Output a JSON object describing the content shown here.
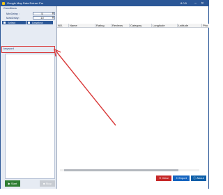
{
  "window": {
    "title": "Google Map Data Extract Pro",
    "version": "8.0.5",
    "min_glyph": "–",
    "close_glyph": "✕"
  },
  "conditions": {
    "group_label": "Conditions",
    "min_delay_label": "MinDelay :",
    "min_delay_value": "5",
    "max_delay_label": "MaxDelay :",
    "max_delay_value": "10",
    "select_label": "Select",
    "deselect_label": "Unselect",
    "keyword_label": "keyword"
  },
  "actions": {
    "start_label": "Start",
    "stop_label": "Stop",
    "clear_label": "Clear",
    "export_label": "Export",
    "about_label": "About"
  },
  "table": {
    "columns": [
      "NO.",
      "Name",
      "Rating",
      "Reviews",
      "Category",
      "Longitude",
      "Latitude",
      "Pho"
    ]
  },
  "icons": {
    "start": "play-icon",
    "stop": "stop-icon",
    "clear": "clear-icon",
    "export": "export-icon",
    "about": "info-icon",
    "app": "app-icon"
  },
  "colors": {
    "chrome_blue": "#2b5797",
    "panel_bg": "#e6ebf3",
    "highlight_red": "#d93a3a",
    "start_green": "#2e7d32",
    "clear_red": "#c62828",
    "export_blue": "#1565c0"
  }
}
